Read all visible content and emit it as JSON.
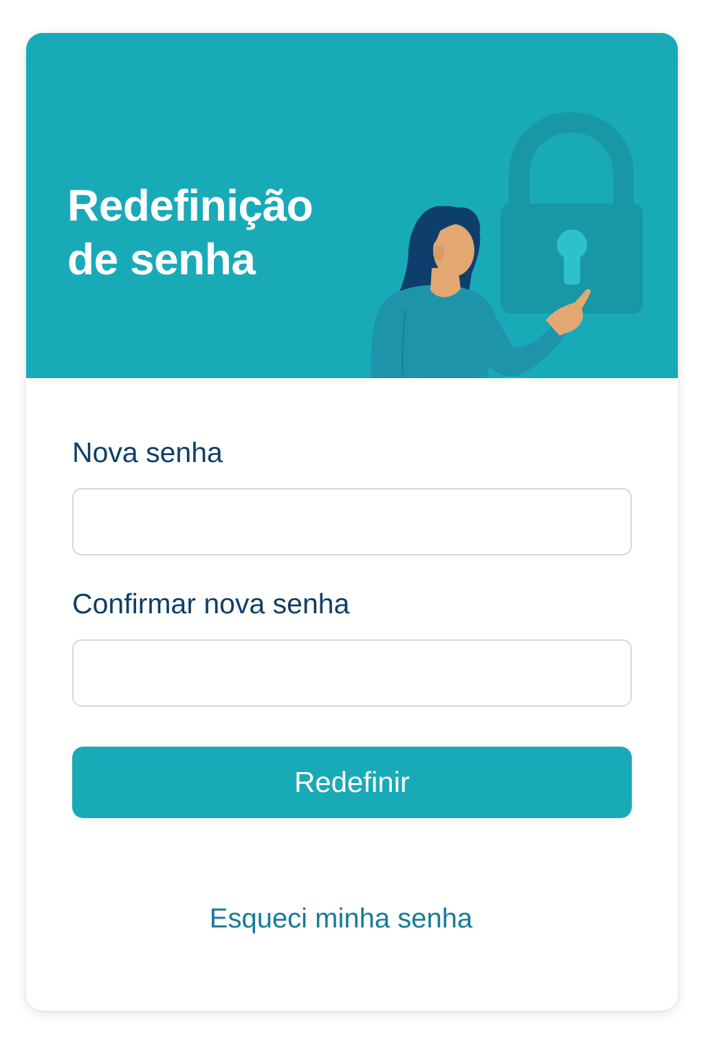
{
  "header": {
    "title_line1": "Redefinição",
    "title_line2": "de senha",
    "illustration": "woman-touching-padlock-illustration"
  },
  "form": {
    "new_password": {
      "label": "Nova senha",
      "value": "",
      "placeholder": ""
    },
    "confirm_password": {
      "label": "Confirmar nova senha",
      "value": "",
      "placeholder": ""
    },
    "submit_label": "Redefinir",
    "forgot_link": "Esqueci minha senha"
  },
  "colors": {
    "accent": "#19aab8",
    "label_text": "#0e3f66",
    "link_text": "#157c98",
    "input_border": "#d5d9de"
  }
}
